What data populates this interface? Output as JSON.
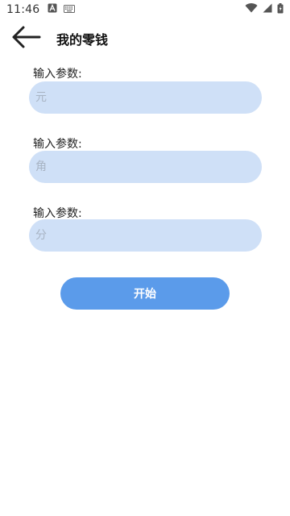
{
  "status_bar": {
    "time": "11:46",
    "left_icons": [
      "a-notification-icon",
      "keyboard-icon"
    ],
    "right_icons": [
      "wifi-icon",
      "signal-icon",
      "battery-icon"
    ]
  },
  "app_bar": {
    "back_icon": "arrow-left-icon",
    "title": "我的零钱"
  },
  "form": {
    "fields": [
      {
        "label": "输入参数:",
        "placeholder": "元",
        "value": ""
      },
      {
        "label": "输入参数:",
        "placeholder": "角",
        "value": ""
      },
      {
        "label": "输入参数:",
        "placeholder": "分",
        "value": ""
      }
    ],
    "submit_label": "开始"
  },
  "colors": {
    "input_background": "#cfe0f7",
    "button_background": "#5b9bea",
    "button_text": "#ffffff"
  }
}
